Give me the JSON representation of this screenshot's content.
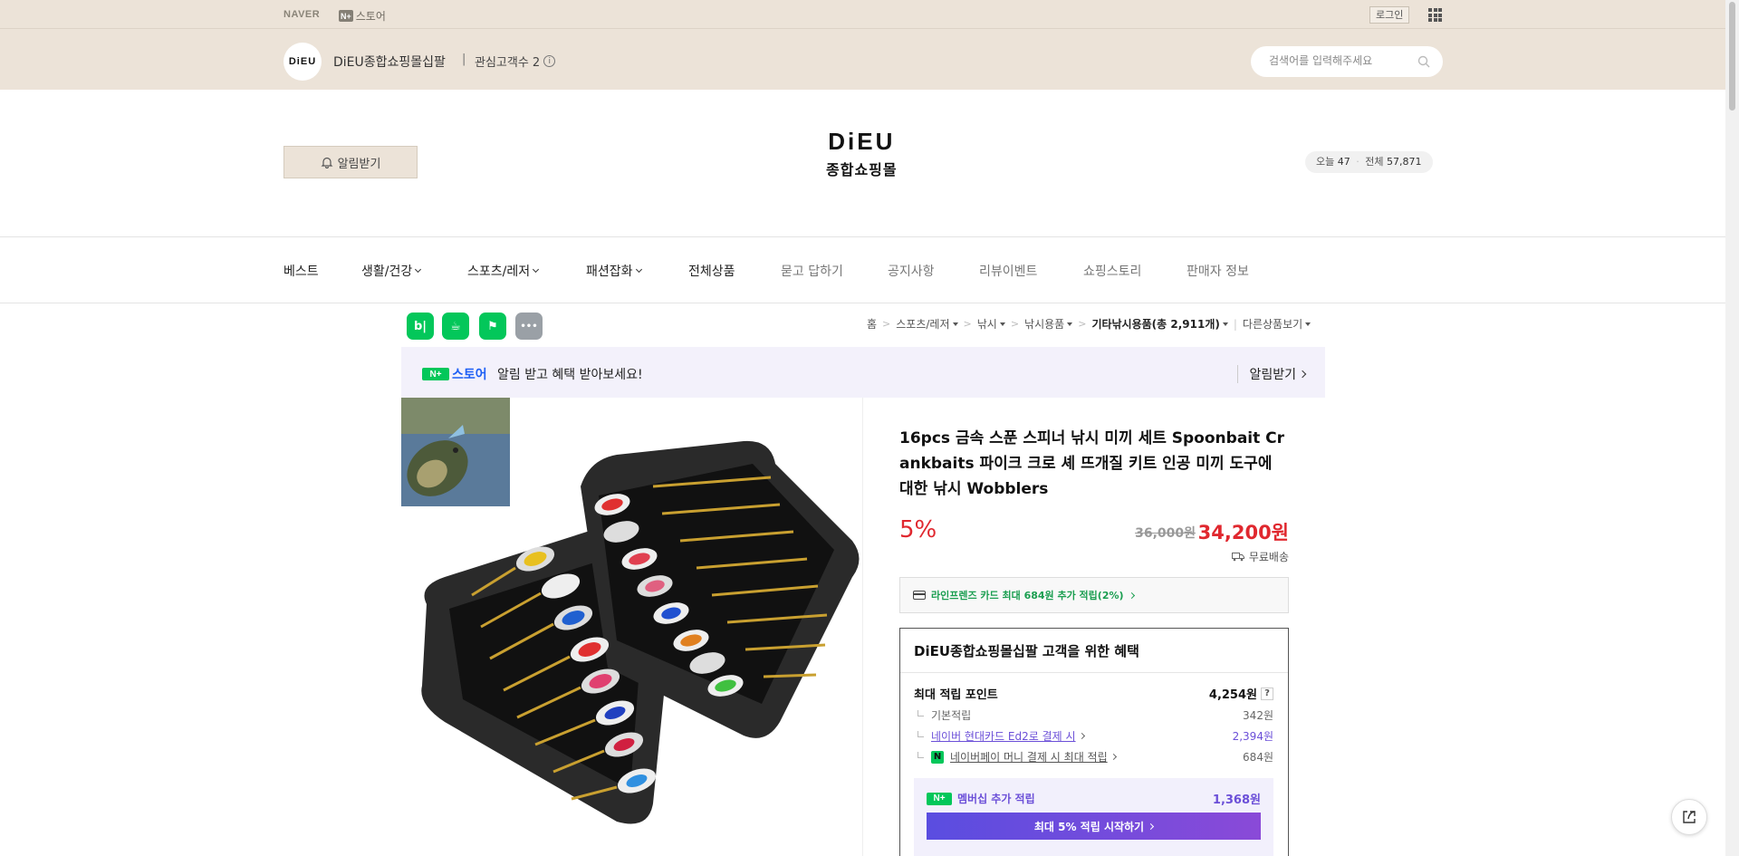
{
  "gnb": {
    "naver_label": "NAVER",
    "store_badge": "N+",
    "store_label": "스토어",
    "login_label": "로그인",
    "apps_icon": "apps-grid-icon"
  },
  "store_header": {
    "logo_text": "DiEU",
    "store_name": "DiEU종합쇼핑몰십팔",
    "separator": "|",
    "fans_label": "관심고객수 2",
    "search_placeholder": "검색어를 입력해주세요",
    "bg_color": "#ece3d8"
  },
  "brand": {
    "notify_label": "알림받기",
    "logo_line1": "DiEU",
    "logo_line2": "종합쇼핑몰",
    "visit_today_label": "오늘",
    "visit_today": "47",
    "visit_total_label": "전체",
    "visit_total": "57,871"
  },
  "nav": [
    {
      "label": "베스트",
      "dropdown": false,
      "gray": false
    },
    {
      "label": "생활/건강",
      "dropdown": true,
      "gray": false
    },
    {
      "label": "스포츠/레저",
      "dropdown": true,
      "gray": false
    },
    {
      "label": "패션잡화",
      "dropdown": true,
      "gray": false
    },
    {
      "label": "전체상품",
      "dropdown": false,
      "gray": false
    },
    {
      "label": "묻고 답하기",
      "dropdown": false,
      "gray": true
    },
    {
      "label": "공지사항",
      "dropdown": false,
      "gray": true
    },
    {
      "label": "리뷰이벤트",
      "dropdown": false,
      "gray": true
    },
    {
      "label": "쇼핑스토리",
      "dropdown": false,
      "gray": true
    },
    {
      "label": "판매자 정보",
      "dropdown": false,
      "gray": true
    }
  ],
  "sns": [
    {
      "name": "blog-share-icon",
      "glyph": "b|",
      "color": "#03c75a"
    },
    {
      "name": "cafe-share-icon",
      "glyph": "☕",
      "color": "#03c75a"
    },
    {
      "name": "bookmark-share-icon",
      "glyph": "⚑",
      "color": "#03c75a"
    },
    {
      "name": "more-share-icon",
      "glyph": "•••",
      "color": "#9aa0a6"
    }
  ],
  "breadcrumb": {
    "home": "홈",
    "c1": "스포츠/레저",
    "c2": "낚시",
    "c3": "낚시용품",
    "c4": "기타낚시용품(총 2,911개)",
    "other": "다른상품보기"
  },
  "notice": {
    "badge": "N+",
    "store": "스토어",
    "message": "알림 받고 혜택 받아보세요!",
    "action": "알림받기"
  },
  "product": {
    "title": "16pcs 금속 스푼 스피너 낚시 미끼 세트 Spoonbait Crankbaits 파이크 크로 셰 뜨개질 키트 인공 미끼 도구에 대한 낚시 Wobblers",
    "discount": "5%",
    "original_price": "36,000원",
    "sale_price": "34,200원",
    "shipping": "무료배송",
    "card_promo": "라인프렌즈 카드 최대 684원 추가 적립(2%)",
    "accent": "#e0282f"
  },
  "benefit": {
    "title": "DiEU종합쇼핑몰십팔 고객을 위한 혜택",
    "max_points_label": "최대 적립 포인트",
    "max_points": "4,254원",
    "help": "?",
    "rows": [
      {
        "label": "기본적립",
        "value": "342원",
        "link": false
      },
      {
        "label": "네이버 현대카드 Ed2로 결제 시",
        "value": "2,394원",
        "link": true
      },
      {
        "label": "네이버페이 머니 결제 시 최대 적립",
        "value": "684원",
        "link": true
      }
    ],
    "member_badge": "N+",
    "member_label": "멤버십 추가 적립",
    "member_value": "1,368원",
    "member_cta": "최대 5% 적립 시작하기"
  }
}
